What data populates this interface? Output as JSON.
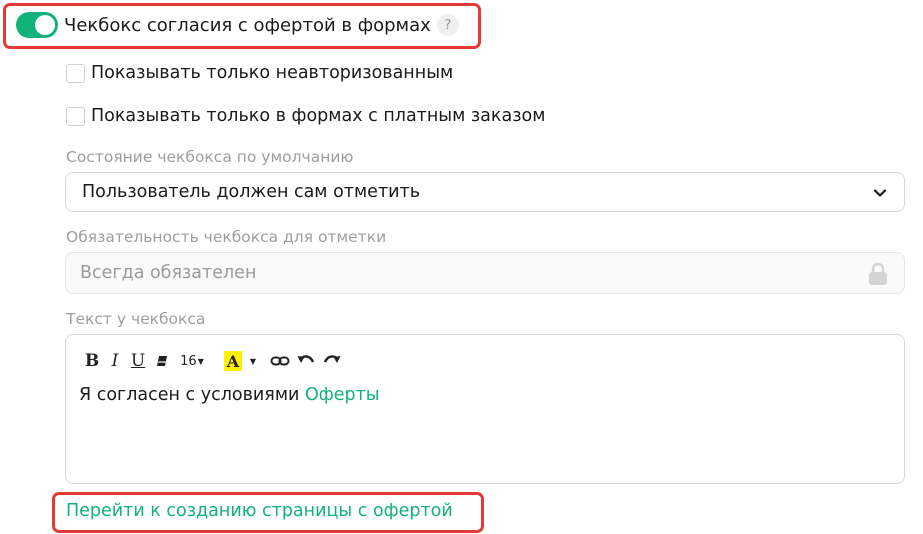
{
  "consent": {
    "toggle_on": true,
    "label": "Чекбокс согласия с офертой в формах",
    "help_glyph": "?"
  },
  "options": [
    {
      "label": "Показывать только неавторизованным",
      "checked": false
    },
    {
      "label": "Показывать только в формах с платным заказом",
      "checked": false
    }
  ],
  "default_state": {
    "label": "Состояние чекбокса по умолчанию",
    "value": "Пользователь должен сам отметить"
  },
  "requirement": {
    "label": "Обязательность чекбокса для отметки",
    "value": "Всегда обязателен",
    "locked": true
  },
  "checkbox_text": {
    "label": "Текст у чекбокса",
    "toolbar": {
      "bold": "B",
      "italic": "I",
      "underline": "U",
      "font_size": "16",
      "text_color_glyph": "A"
    },
    "content_prefix": "Я согласен с условиями ",
    "content_link": "Оферты"
  },
  "create_offer_link": "Перейти к созданию страницы с офертой",
  "colors": {
    "accent": "#12b37a",
    "highlight": "#e53935",
    "text_color_swatch": "#fff200"
  }
}
